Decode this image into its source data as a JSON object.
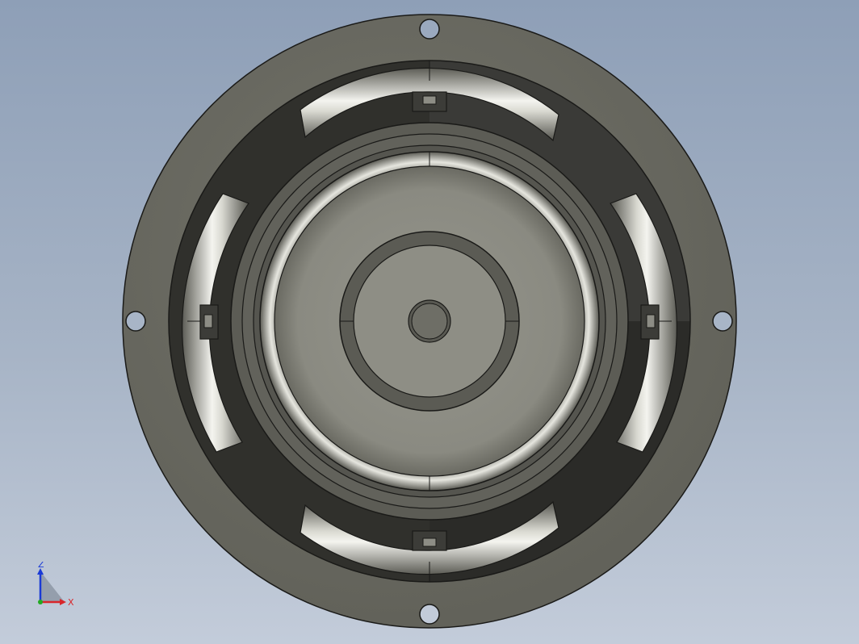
{
  "viewport": {
    "background_top": "#8e9fb7",
    "background_bottom": "#c3ccda"
  },
  "model": {
    "part_type": "speaker",
    "view": "front",
    "colors": {
      "flange": "#6c6c62",
      "frame_dark": "#2d2d29",
      "frame_mid": "#3b3b37",
      "cone": "#8f8f86",
      "cap_ring": "#5d5d56",
      "dust_cap": "#6f6f67",
      "edge_line": "#1a1a18",
      "window_highlight": "#f2f2ec"
    },
    "mounting_holes": 4,
    "spoke_windows": 4
  },
  "triad": {
    "z_label": "Z",
    "x_label": "X",
    "z_color": "#1a3ad6",
    "x_color": "#d8262b"
  }
}
